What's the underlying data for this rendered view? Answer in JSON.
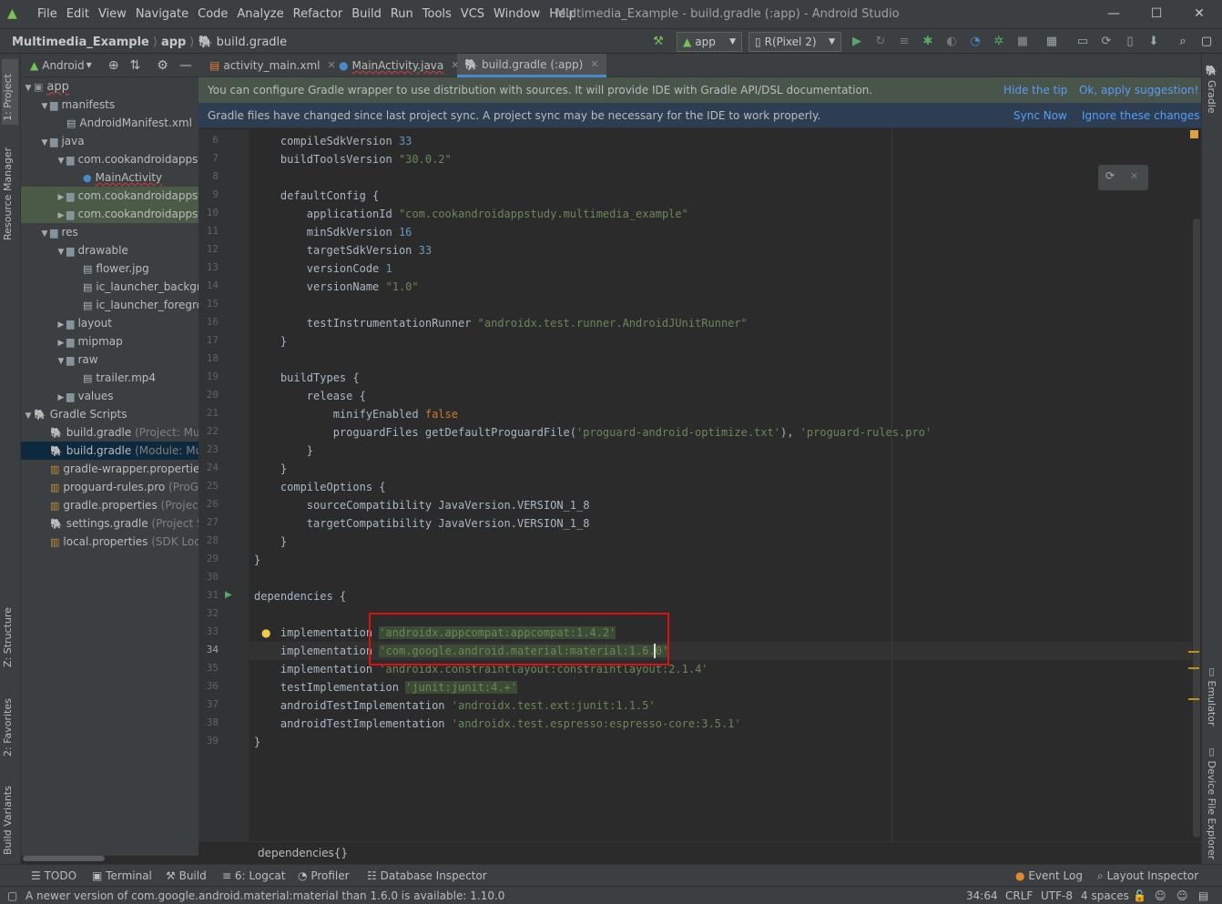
{
  "window": {
    "menu": [
      "File",
      "Edit",
      "View",
      "Navigate",
      "Code",
      "Analyze",
      "Refactor",
      "Build",
      "Run",
      "Tools",
      "VCS",
      "Window",
      "Help"
    ],
    "title": "Multimedia_Example - build.gradle (:app) - Android Studio"
  },
  "breadcrumb": [
    "Multimedia_Example",
    "app",
    "build.gradle"
  ],
  "toolbar": {
    "run_config": "app",
    "device": "R(Pixel 2)"
  },
  "project_panel": {
    "view": "Android",
    "tree": [
      {
        "label": "app",
        "depth": 0,
        "arrow": "▼",
        "kind": "module"
      },
      {
        "label": "manifests",
        "depth": 1,
        "arrow": "▼",
        "kind": "folder"
      },
      {
        "label": "AndroidManifest.xml",
        "depth": 2,
        "arrow": "",
        "kind": "file"
      },
      {
        "label": "java",
        "depth": 1,
        "arrow": "▼",
        "kind": "folder"
      },
      {
        "label": "com.cookandroidappstudy",
        "depth": 2,
        "arrow": "▼",
        "kind": "folder"
      },
      {
        "label": "MainActivity",
        "depth": 3,
        "arrow": "",
        "kind": "class"
      },
      {
        "label": "com.cookandroidappstudy",
        "depth": 2,
        "arrow": "▶",
        "kind": "folder",
        "hl": true
      },
      {
        "label": "com.cookandroidappstudy",
        "depth": 2,
        "arrow": "▶",
        "kind": "folder",
        "hl": true
      },
      {
        "label": "res",
        "depth": 1,
        "arrow": "▼",
        "kind": "folder"
      },
      {
        "label": "drawable",
        "depth": 2,
        "arrow": "▼",
        "kind": "folder"
      },
      {
        "label": "flower.jpg",
        "depth": 3,
        "arrow": "",
        "kind": "file"
      },
      {
        "label": "ic_launcher_background",
        "depth": 3,
        "arrow": "",
        "kind": "file"
      },
      {
        "label": "ic_launcher_foreground",
        "depth": 3,
        "arrow": "",
        "kind": "file"
      },
      {
        "label": "layout",
        "depth": 2,
        "arrow": "▶",
        "kind": "folder"
      },
      {
        "label": "mipmap",
        "depth": 2,
        "arrow": "▶",
        "kind": "folder"
      },
      {
        "label": "raw",
        "depth": 2,
        "arrow": "▼",
        "kind": "folder"
      },
      {
        "label": "trailer.mp4",
        "depth": 3,
        "arrow": "",
        "kind": "file"
      },
      {
        "label": "values",
        "depth": 2,
        "arrow": "▶",
        "kind": "folder"
      },
      {
        "label": "Gradle Scripts",
        "depth": 0,
        "arrow": "▼",
        "kind": "gradle"
      },
      {
        "label": "build.gradle",
        "suffix": " (Project: Multimedia_Example)",
        "depth": 1,
        "arrow": "",
        "kind": "gradle"
      },
      {
        "label": "build.gradle",
        "suffix": " (Module: Multimedia_Example.app)",
        "depth": 1,
        "arrow": "",
        "kind": "gradle",
        "sel": true
      },
      {
        "label": "gradle-wrapper.properties",
        "suffix": "",
        "depth": 1,
        "arrow": "",
        "kind": "prop"
      },
      {
        "label": "proguard-rules.pro",
        "suffix": " (ProGuard Rules)",
        "depth": 1,
        "arrow": "",
        "kind": "prop"
      },
      {
        "label": "gradle.properties",
        "suffix": " (Project Properties)",
        "depth": 1,
        "arrow": "",
        "kind": "prop"
      },
      {
        "label": "settings.gradle",
        "suffix": " (Project Settings)",
        "depth": 1,
        "arrow": "",
        "kind": "gradle"
      },
      {
        "label": "local.properties",
        "suffix": " (SDK Location)",
        "depth": 1,
        "arrow": "",
        "kind": "prop"
      }
    ]
  },
  "tabs": [
    {
      "label": "activity_main.xml"
    },
    {
      "label": "MainActivity.java"
    },
    {
      "label": "build.gradle (:app)"
    }
  ],
  "banners": {
    "wrapper": {
      "text": "You can configure Gradle wrapper to use distribution with sources. It will provide IDE with Gradle API/DSL documentation.",
      "action1": "Hide the tip",
      "action2": "Ok, apply suggestion!"
    },
    "sync": {
      "text": "Gradle files have changed since last project sync. A project sync may be necessary for the IDE to work properly.",
      "action1": "Sync Now",
      "action2": "Ignore these changes"
    }
  },
  "editor": {
    "lines": [
      {
        "n": "6",
        "parts": [
          [
            "",
            "    compileSdkVersion "
          ],
          [
            "num",
            "33"
          ]
        ]
      },
      {
        "n": "7",
        "parts": [
          [
            "",
            "    buildToolsVersion "
          ],
          [
            "str",
            "\"30.0.2\""
          ]
        ]
      },
      {
        "n": "8",
        "parts": []
      },
      {
        "n": "9",
        "parts": [
          [
            "",
            "    defaultConfig {"
          ]
        ]
      },
      {
        "n": "10",
        "parts": [
          [
            "",
            "        applicationId "
          ],
          [
            "str",
            "\"com.cookandroidappstudy.multimedia_example\""
          ]
        ]
      },
      {
        "n": "11",
        "parts": [
          [
            "",
            "        minSdkVersion "
          ],
          [
            "num",
            "16"
          ]
        ]
      },
      {
        "n": "12",
        "parts": [
          [
            "",
            "        targetSdkVersion "
          ],
          [
            "num",
            "33"
          ]
        ]
      },
      {
        "n": "13",
        "parts": [
          [
            "",
            "        versionCode "
          ],
          [
            "num",
            "1"
          ]
        ]
      },
      {
        "n": "14",
        "parts": [
          [
            "",
            "        versionName "
          ],
          [
            "str",
            "\"1.0\""
          ]
        ]
      },
      {
        "n": "15",
        "parts": []
      },
      {
        "n": "16",
        "parts": [
          [
            "",
            "        testInstrumentationRunner "
          ],
          [
            "str",
            "\"androidx.test.runner.AndroidJUnitRunner\""
          ]
        ]
      },
      {
        "n": "17",
        "parts": [
          [
            "",
            "    }"
          ]
        ]
      },
      {
        "n": "18",
        "parts": []
      },
      {
        "n": "19",
        "parts": [
          [
            "",
            "    buildTypes {"
          ]
        ]
      },
      {
        "n": "20",
        "parts": [
          [
            "",
            "        release {"
          ]
        ]
      },
      {
        "n": "21",
        "parts": [
          [
            "",
            "            minifyEnabled "
          ],
          [
            "kw",
            "false"
          ]
        ]
      },
      {
        "n": "22",
        "parts": [
          [
            "",
            "            proguardFiles getDefaultProguardFile("
          ],
          [
            "str",
            "'proguard-android-optimize.txt'"
          ],
          [
            "",
            "), "
          ],
          [
            "str",
            "'proguard-rules.pro'"
          ]
        ]
      },
      {
        "n": "23",
        "parts": [
          [
            "",
            "        }"
          ]
        ]
      },
      {
        "n": "24",
        "parts": [
          [
            "",
            "    }"
          ]
        ]
      },
      {
        "n": "25",
        "parts": [
          [
            "",
            "    compileOptions {"
          ]
        ]
      },
      {
        "n": "26",
        "parts": [
          [
            "",
            "        sourceCompatibility JavaVersion.VERSION_1_8"
          ]
        ]
      },
      {
        "n": "27",
        "parts": [
          [
            "",
            "        targetCompatibility JavaVersion.VERSION_1_8"
          ]
        ]
      },
      {
        "n": "28",
        "parts": [
          [
            "",
            "    }"
          ]
        ]
      },
      {
        "n": "29",
        "parts": [
          [
            "",
            "}"
          ]
        ]
      },
      {
        "n": "30",
        "parts": []
      },
      {
        "n": "31",
        "parts": [
          [
            "",
            "dependencies {"
          ]
        ]
      },
      {
        "n": "32",
        "parts": []
      },
      {
        "n": "33",
        "parts": [
          [
            "",
            "    implementation "
          ],
          [
            "strbg",
            "'androidx.appcompat:appcompat:1.4.2'"
          ]
        ]
      },
      {
        "n": "34",
        "parts": [
          [
            "",
            "    implementation "
          ],
          [
            "strbg",
            "'com.google.android.material:material:1.6.0'"
          ]
        ]
      },
      {
        "n": "35",
        "parts": [
          [
            "",
            "    implementation "
          ],
          [
            "str",
            "'androidx.constraintlayout:constraintlayout:2.1.4'"
          ]
        ]
      },
      {
        "n": "36",
        "parts": [
          [
            "",
            "    testImplementation "
          ],
          [
            "strbg",
            "'junit:junit:4.+'"
          ]
        ]
      },
      {
        "n": "37",
        "parts": [
          [
            "",
            "    androidTestImplementation "
          ],
          [
            "str",
            "'androidx.test.ext:junit:1.1.5'"
          ]
        ]
      },
      {
        "n": "38",
        "parts": [
          [
            "",
            "    androidTestImplementation "
          ],
          [
            "str",
            "'androidx.test.espresso:espresso-core:3.5.1'"
          ]
        ]
      },
      {
        "n": "39",
        "parts": [
          [
            "",
            "}"
          ]
        ]
      }
    ],
    "breadcrumb": "dependencies{}"
  },
  "side_tabs": {
    "left": [
      "1: Project",
      "Resource Manager",
      "Z: Structure",
      "2: Favorites",
      "Build Variants"
    ],
    "right": [
      "Gradle",
      "Emulator",
      "Device File Explorer"
    ]
  },
  "bottom_tools": [
    "TODO",
    "Terminal",
    "Build",
    "6: Logcat",
    "Profiler",
    "Database Inspector",
    "Event Log",
    "Layout Inspector"
  ],
  "status": {
    "message": "A newer version of com.google.android.material:material than 1.6.0 is available: 1.10.0",
    "position": "34:64",
    "line_sep": "CRLF",
    "encoding": "UTF-8",
    "indent": "4 spaces"
  },
  "colors": {
    "accent": "#4a88c7",
    "highlight_box": "#e01010",
    "string": "#6a8759",
    "keyword": "#cc7832",
    "number": "#6897bb"
  }
}
